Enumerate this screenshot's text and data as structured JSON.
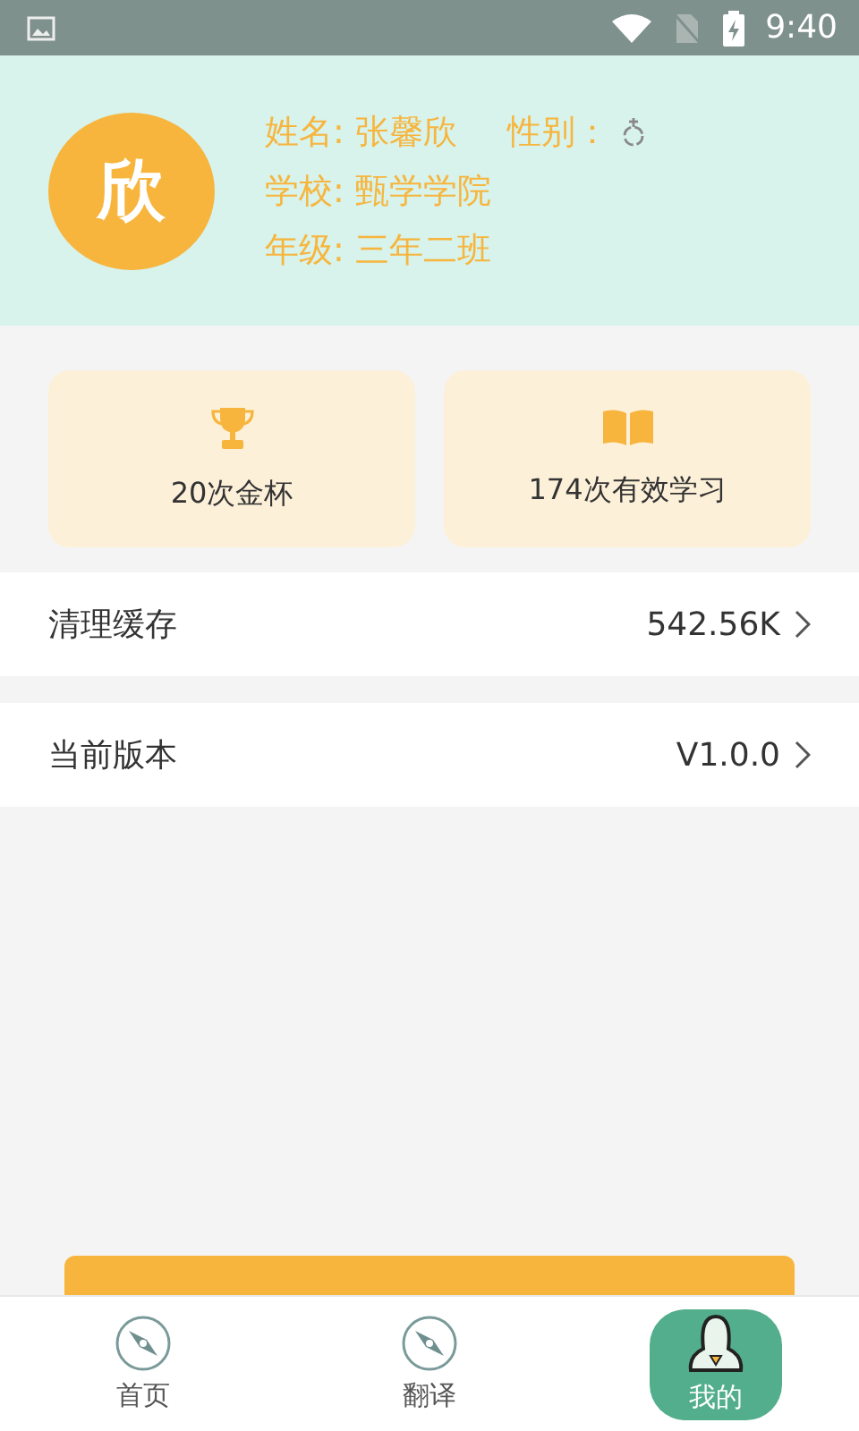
{
  "status_bar": {
    "time": "9:40"
  },
  "profile": {
    "avatar": "欣",
    "name_label": "姓名: 张馨欣",
    "gender_label": "性别：",
    "school": "学校: 甄学学院",
    "grade": "年级: 三年二班"
  },
  "stats": [
    {
      "kind": "trophy",
      "label": "20次金杯"
    },
    {
      "kind": "book",
      "label": "174次有效学习"
    }
  ],
  "settings": [
    {
      "label": "清理缓存",
      "value": "542.56K"
    },
    {
      "label": "当前版本",
      "value": "V1.0.0"
    }
  ],
  "tabs": [
    {
      "label": "首页",
      "kind": "compass",
      "selected": false
    },
    {
      "label": "翻译",
      "kind": "compass",
      "selected": false
    },
    {
      "label": "我的",
      "kind": "person",
      "selected": true
    }
  ]
}
